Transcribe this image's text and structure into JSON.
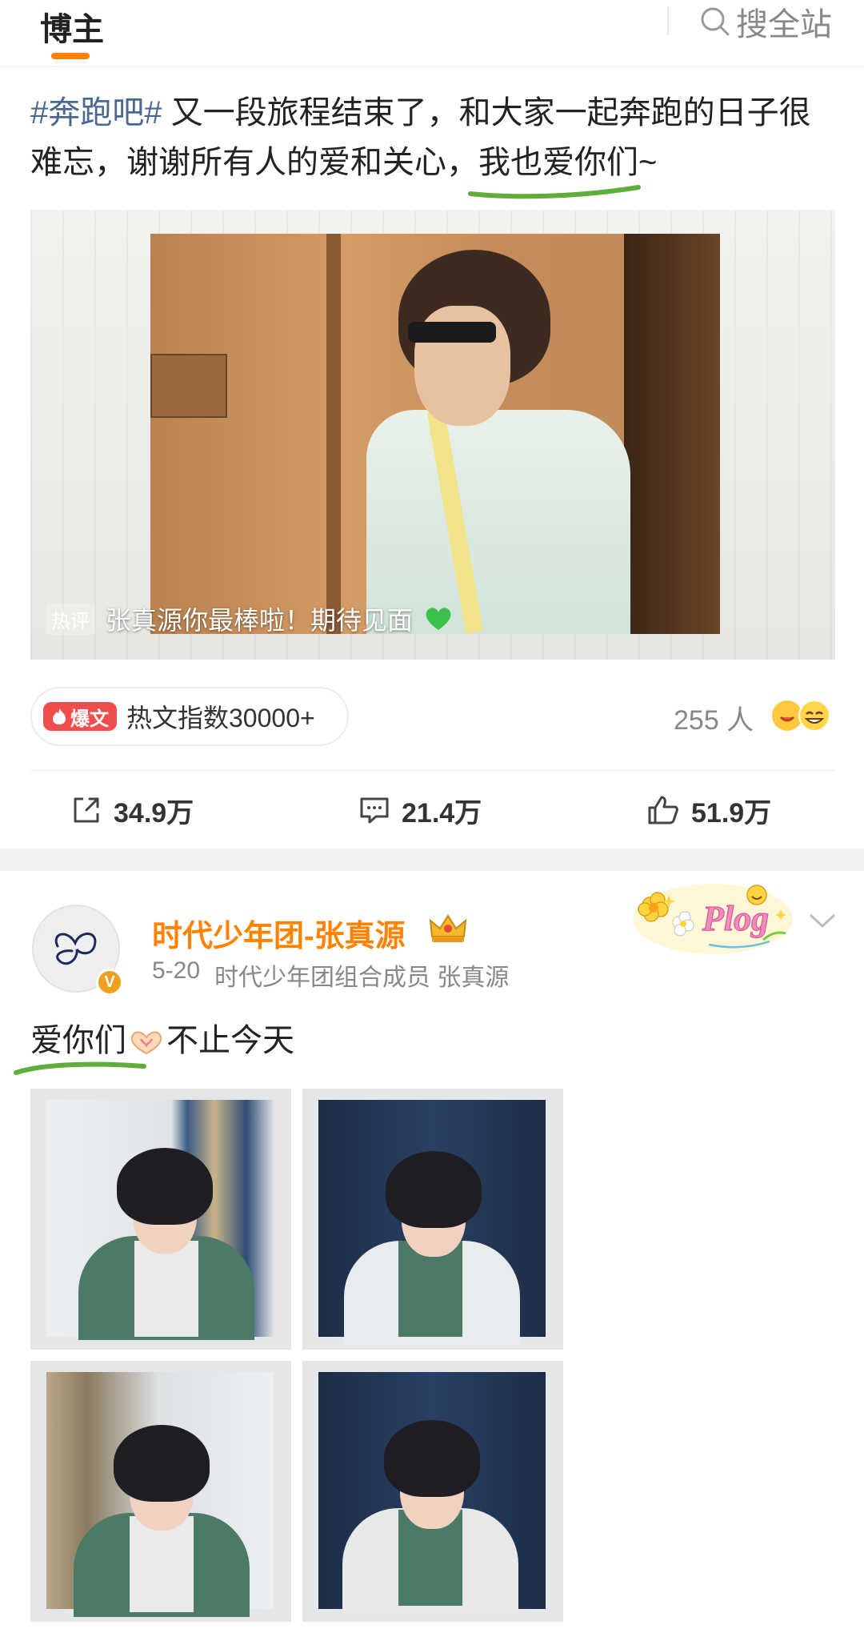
{
  "topbar": {
    "tab_label": "博主",
    "search_label": "搜全站"
  },
  "post1": {
    "hashtag": "#奔跑吧#",
    "text_main": " 又一段旅程结束了，和大家一起奔跑的日子很难忘，谢谢所有人的爱和关心，",
    "text_underlined": "我也爱你们~",
    "hot_comment_tag": "热评",
    "hot_comment_text": "张真源你最棒啦！期待见面",
    "hot_badge": "爆文",
    "hot_index": "热文指数30000+",
    "people_count": "255 人",
    "actions": {
      "repost": "34.9万",
      "comment": "21.4万",
      "like": "51.9万"
    }
  },
  "post2": {
    "author": "时代少年团-张真源",
    "date": "5-20",
    "bio": "时代少年团组合成员 张真源",
    "verified_badge": "V",
    "plog_label": "Plog",
    "text_underlined": "爱你们",
    "text_rest": "不止今天"
  },
  "colors": {
    "accent": "#ff8200",
    "hashtag": "#4a6890",
    "underline": "#5fae3c",
    "hot_badge": "#f04e4e"
  },
  "icons": [
    "search-icon",
    "repost-icon",
    "comment-icon",
    "like-icon",
    "chevron-down-icon",
    "crown-icon",
    "verified-icon"
  ]
}
